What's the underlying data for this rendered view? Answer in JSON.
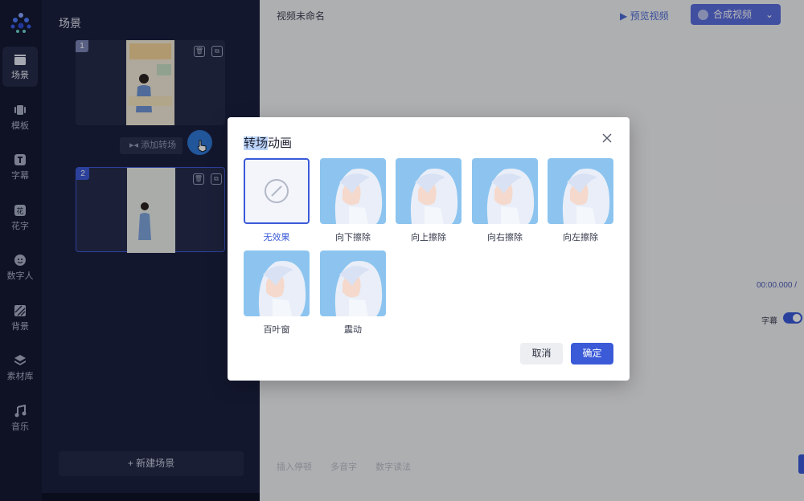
{
  "nav": {
    "items": [
      {
        "label": "场景",
        "icon": "clapperboard-icon",
        "active": true
      },
      {
        "label": "模板",
        "icon": "template-icon"
      },
      {
        "label": "字幕",
        "icon": "text-icon"
      },
      {
        "label": "花字",
        "icon": "fancy-text-icon"
      },
      {
        "label": "数字人",
        "icon": "digital-human-icon"
      },
      {
        "label": "背景",
        "icon": "background-icon"
      },
      {
        "label": "素材库",
        "icon": "layers-icon"
      },
      {
        "label": "音乐",
        "icon": "music-icon"
      }
    ]
  },
  "scene_panel": {
    "title": "场景",
    "scenes": [
      {
        "number": "1"
      },
      {
        "number": "2"
      }
    ],
    "add_transition": "添加转场",
    "new_scene": "+ 新建场景"
  },
  "workspace": {
    "project_title": "视频未命名",
    "preview": "预览视频",
    "compose": "合成视频",
    "time": "00:00.000 /",
    "subtitle_toggle_label": "字幕",
    "subtitle_on": true,
    "tools": [
      "插入停顿",
      "多音字",
      "数字读法"
    ]
  },
  "modal": {
    "title_highlight": "转场",
    "title_rest": "动画",
    "options": [
      {
        "label": "无效果",
        "selected": true
      },
      {
        "label": "向下擦除"
      },
      {
        "label": "向上擦除"
      },
      {
        "label": "向右擦除"
      },
      {
        "label": "向左擦除"
      },
      {
        "label": "百叶窗"
      },
      {
        "label": "震动"
      }
    ],
    "cancel": "取消",
    "confirm": "确定"
  },
  "colors": {
    "accent": "#3a5ad8",
    "sidebar": "#141a33",
    "panel": "#1b2140"
  }
}
